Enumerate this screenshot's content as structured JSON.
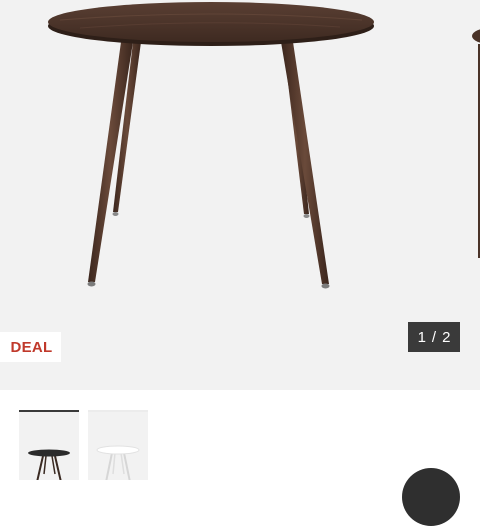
{
  "gallery": {
    "product_image": "round-dining-table-walnut",
    "badge": {
      "label": "DEAL",
      "color": "#c0392b"
    },
    "pager": {
      "current": "1",
      "separator": "/",
      "total": "2"
    }
  },
  "thumbnails": [
    {
      "image": "round-table-dark-top",
      "selected": true
    },
    {
      "image": "round-table-white-top",
      "selected": false
    }
  ],
  "colors": {
    "gallery_bg": "#f2f2f2",
    "table_wood": "#4a3328",
    "pager_bg": "#3a3a3a",
    "badge_text": "#c0392b"
  }
}
